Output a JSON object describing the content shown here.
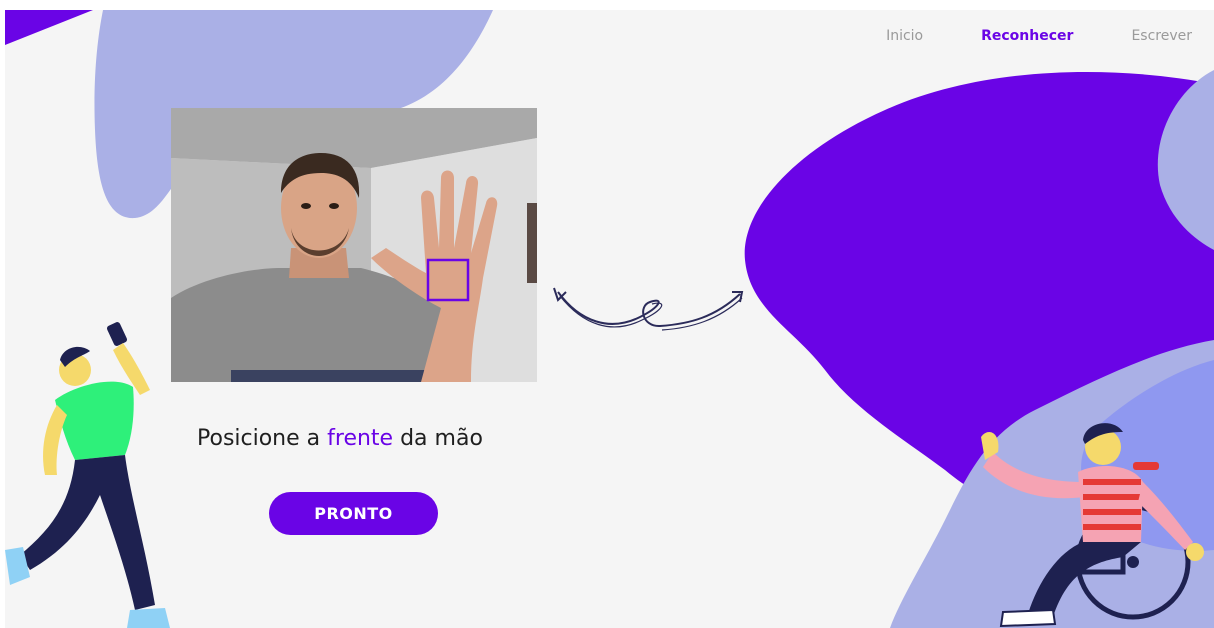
{
  "colors": {
    "accent": "#6a04e6",
    "blob_light": "#aab0e6",
    "background": "#f5f5f5",
    "nav_inactive": "#9a9a9a"
  },
  "nav": {
    "items": [
      {
        "label": "Inicio",
        "active": false
      },
      {
        "label": "Reconhecer",
        "active": true
      },
      {
        "label": "Escrever",
        "active": false
      }
    ]
  },
  "camera": {
    "icon": "webcam-feed"
  },
  "instruction": {
    "prefix": "Posicione a ",
    "highlight": "frente",
    "suffix": " da mão"
  },
  "button": {
    "label": "PRONTO"
  },
  "decorations": {
    "arrow_icon": "squiggle-double-arrow-icon",
    "left_illustration": "dancing-person-with-phone",
    "right_illustration": "waving-person-in-wheelchair"
  }
}
